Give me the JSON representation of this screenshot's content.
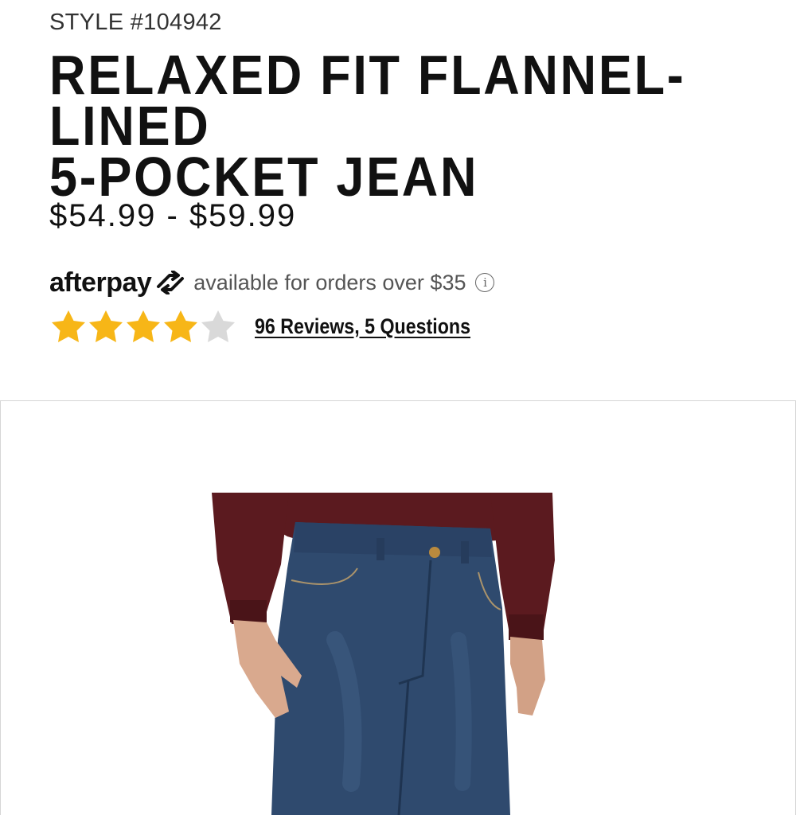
{
  "product": {
    "style_number": "STYLE #104942",
    "title_line1": "RELAXED FIT FLANNEL-LINED",
    "title_line2": "5-POCKET JEAN",
    "price_range": "$54.99 - $59.99"
  },
  "afterpay": {
    "logo_text": "afterpay",
    "message": "available for orders over $35",
    "info_icon": "info-icon"
  },
  "rating": {
    "value": 4,
    "max": 5,
    "star_color": "#F7B617",
    "empty_star_color": "#D9D9D9",
    "reviews_link": "96 Reviews, 5 Questions"
  },
  "gallery": {
    "image_subject": "Man wearing dark denim relaxed fit jeans and maroon long-sleeve shirt",
    "shirt_color": "#5B1A1F",
    "denim_color": "#2F4A6E"
  }
}
